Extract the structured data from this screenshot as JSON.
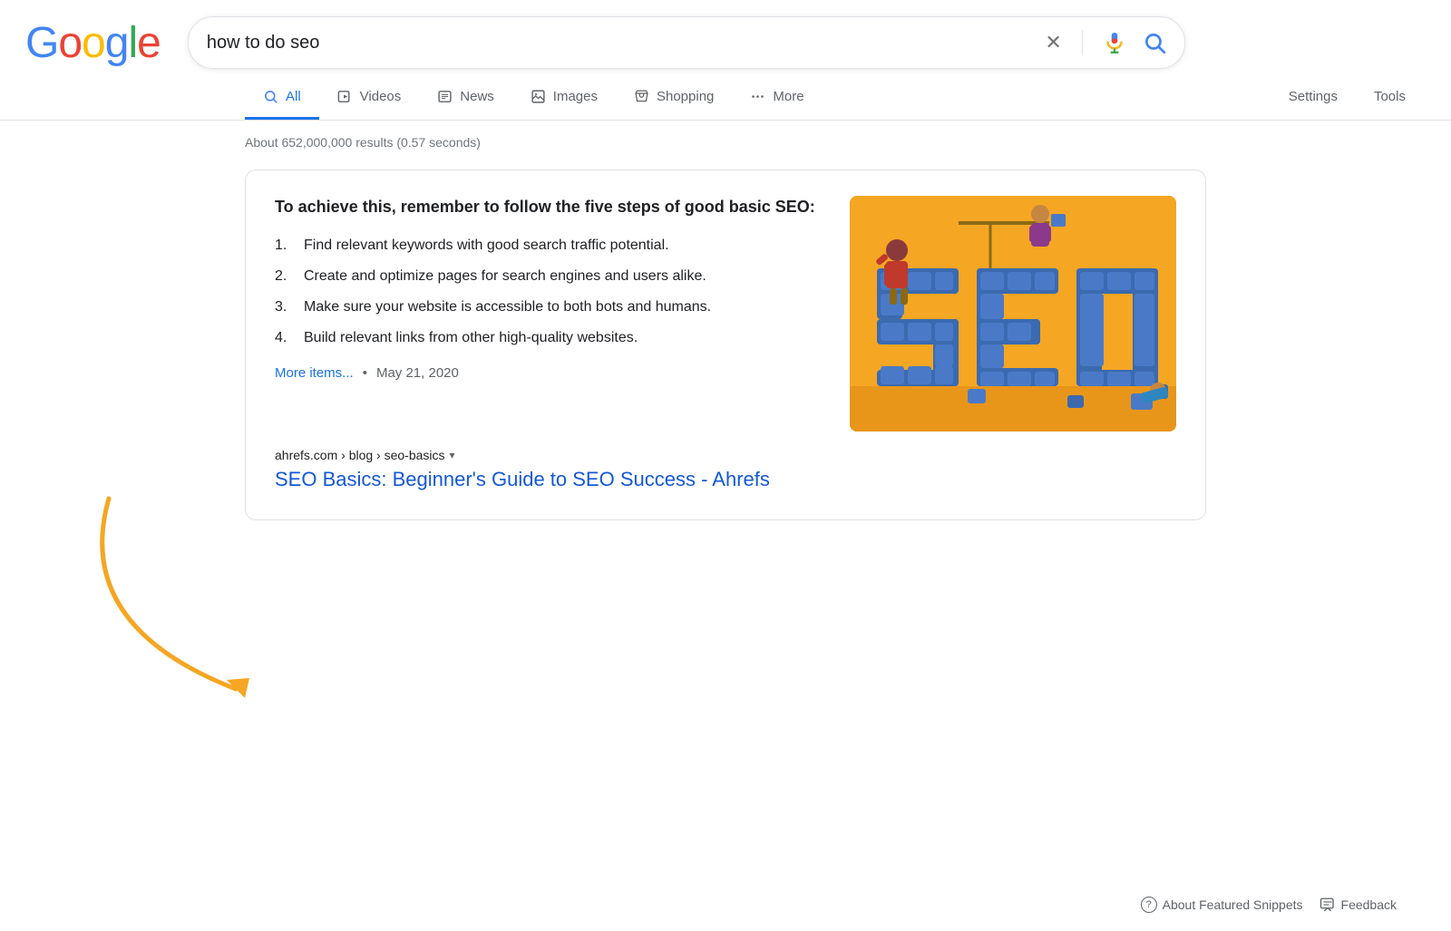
{
  "header": {
    "logo_letters": [
      "G",
      "o",
      "o",
      "g",
      "l",
      "e"
    ],
    "search_value": "how to do seo"
  },
  "nav": {
    "tabs": [
      {
        "id": "all",
        "label": "All",
        "icon": "search",
        "active": true
      },
      {
        "id": "videos",
        "label": "Videos",
        "icon": "play"
      },
      {
        "id": "news",
        "label": "News",
        "icon": "newspaper"
      },
      {
        "id": "images",
        "label": "Images",
        "icon": "image"
      },
      {
        "id": "shopping",
        "label": "Shopping",
        "icon": "tag"
      },
      {
        "id": "more",
        "label": "More",
        "icon": "dots"
      }
    ],
    "settings_label": "Settings",
    "tools_label": "Tools"
  },
  "results": {
    "count_text": "About 652,000,000 results (0.57 seconds)",
    "snippet": {
      "title": "To achieve this, remember to follow the five steps of good basic SEO:",
      "list_items": [
        {
          "num": "1.",
          "text": "Find relevant keywords with good search traffic potential."
        },
        {
          "num": "2.",
          "text": "Create and optimize pages for search engines and users alike."
        },
        {
          "num": "3.",
          "text": "Make sure your website is accessible to both bots and humans."
        },
        {
          "num": "4.",
          "text": "Build relevant links from other high-quality websites."
        }
      ],
      "more_items_label": "More items...",
      "date": "May 21, 2020",
      "source_breadcrumb": "ahrefs.com › blog › seo-basics",
      "result_title": "SEO Basics: Beginner's Guide to SEO Success - Ahrefs"
    }
  },
  "footer": {
    "about_snippets_label": "About Featured Snippets",
    "feedback_label": "Feedback"
  },
  "colors": {
    "google_blue": "#4285F4",
    "google_red": "#EA4335",
    "google_yellow": "#FBBC05",
    "google_green": "#34A853",
    "link_blue": "#1558d6",
    "tab_active": "#1a73e8",
    "orange_annotation": "#F5A623"
  }
}
